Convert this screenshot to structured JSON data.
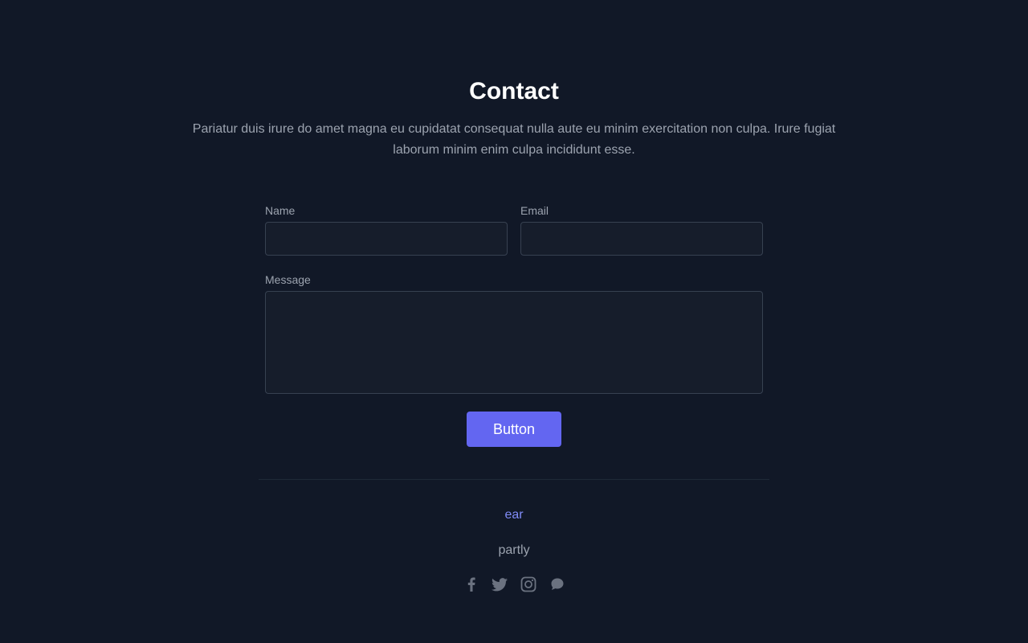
{
  "header": {
    "title": "Contact",
    "description": "Pariatur duis irure do amet magna eu cupidatat consequat nulla aute eu minim exercitation non culpa. Irure fugiat laborum minim enim culpa incididunt esse."
  },
  "form": {
    "name_label": "Name",
    "name_value": "",
    "email_label": "Email",
    "email_value": "",
    "message_label": "Message",
    "message_value": "",
    "submit_label": "Button"
  },
  "footer": {
    "link_text": "ear",
    "text": "partly",
    "social_icons": [
      "facebook-icon",
      "twitter-icon",
      "instagram-icon",
      "chat-icon"
    ]
  },
  "colors": {
    "background": "#111827",
    "accent": "#6366f1",
    "link": "#818cf8",
    "muted_text": "#9ca3af",
    "input_background": "#161d2b",
    "input_border": "#374151",
    "icon": "#6b7280"
  }
}
